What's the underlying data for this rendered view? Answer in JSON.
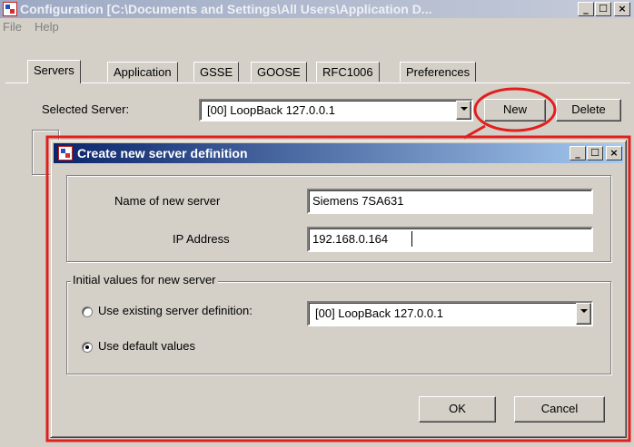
{
  "main_window": {
    "title": "Configuration [C:\\Documents and Settings\\All Users\\Application D...",
    "menu": [
      "File",
      "Help"
    ],
    "tabs": [
      "Servers",
      "Application",
      "GSSE",
      "GOOSE",
      "RFC1006",
      "Preferences"
    ],
    "active_tab": "Servers",
    "selected_server_label": "Selected Server:",
    "selected_server_value": "[00] LoopBack 127.0.0.1",
    "new_button": "New",
    "delete_button": "Delete"
  },
  "dialog": {
    "title": "Create new server definition",
    "name_label": "Name of new server",
    "name_value": "Siemens 7SA631",
    "ip_label": "IP Address",
    "ip_value": "192.168.0.164",
    "group_title": "Initial values for new server",
    "option_existing": "Use existing server definition:",
    "existing_value": "[00] LoopBack 127.0.0.1",
    "option_default": "Use default values",
    "selected_option": "default",
    "ok_button": "OK",
    "cancel_button": "Cancel"
  },
  "caption_buttons": {
    "minimize": "_",
    "maximize": "☐",
    "close": "×"
  },
  "colors": {
    "highlight_red": "#e0201e",
    "title_active": "#0a246a",
    "title_inactive": "#9da9c4",
    "face": "#d4d0c8"
  }
}
